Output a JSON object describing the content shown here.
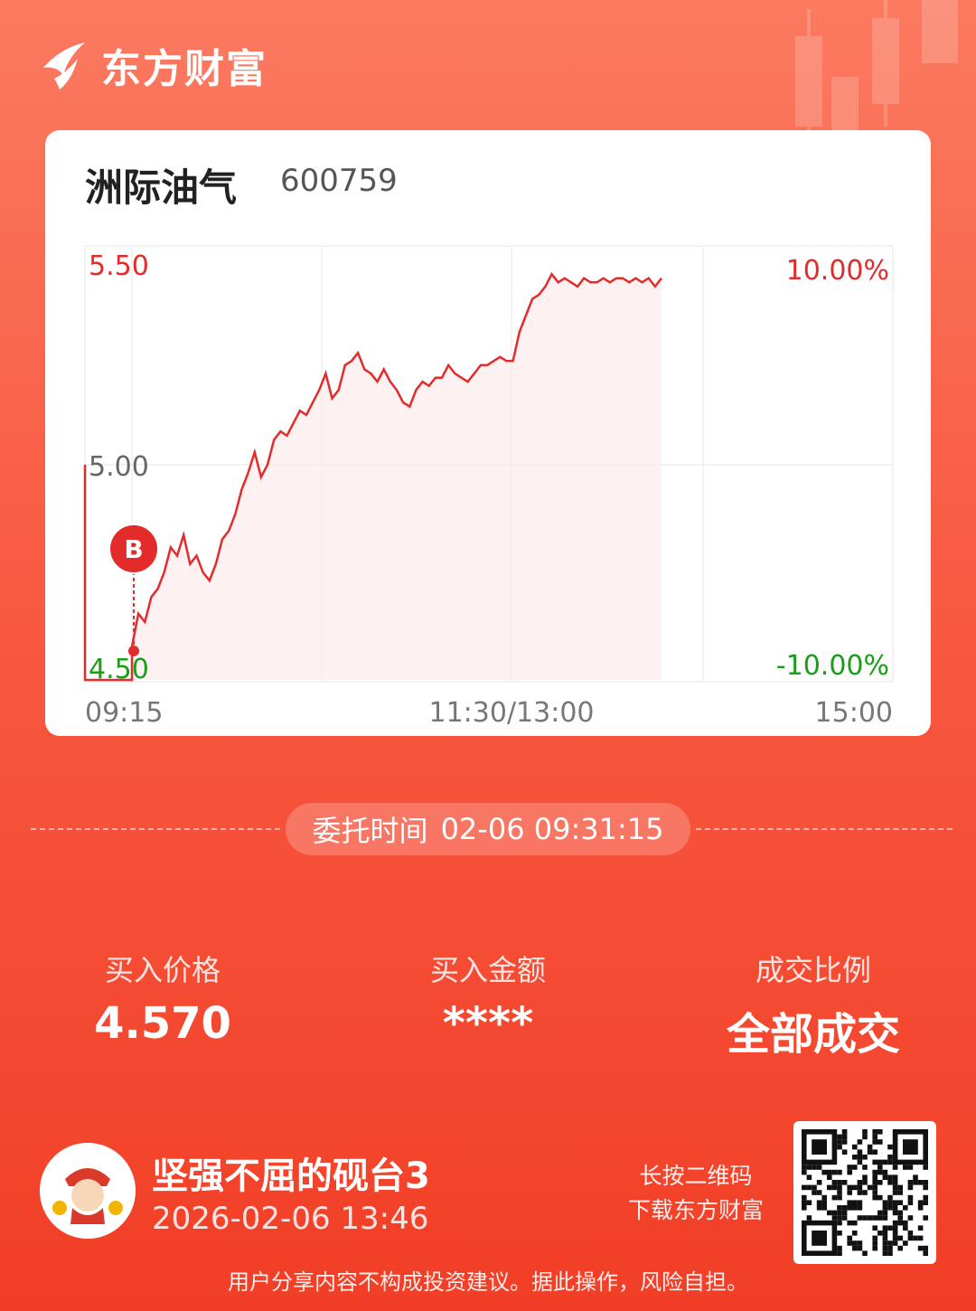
{
  "brand": {
    "name": "东方财富"
  },
  "stock": {
    "name": "洲际油气",
    "code": "600759"
  },
  "chart_data": {
    "type": "line",
    "y_axis_left": [
      "5.50",
      "5.00",
      "4.50"
    ],
    "y_axis_right": [
      "10.00%",
      "-10.00%"
    ],
    "x_labels": [
      "09:15",
      "11:30/13:00",
      "15:00"
    ],
    "ylim": [
      4.5,
      5.5
    ],
    "buy_marker": {
      "label": "B",
      "price": 4.57
    },
    "series": [
      {
        "values": [
          4.58,
          4.66,
          4.64,
          4.7,
          4.72,
          4.76,
          4.82,
          4.8,
          4.85,
          4.78,
          4.8,
          4.76,
          4.74,
          4.78,
          4.84,
          4.86,
          4.9,
          4.96,
          5.0,
          5.05,
          4.99,
          5.02,
          5.08,
          5.1,
          5.09,
          5.12,
          5.15,
          5.14,
          5.17,
          5.2,
          5.24,
          5.18,
          5.2,
          5.26,
          5.27,
          5.29,
          5.25,
          5.24,
          5.22,
          5.25,
          5.22,
          5.2,
          5.17,
          5.16,
          5.2,
          5.22,
          5.21,
          5.23,
          5.23,
          5.26,
          5.24,
          5.23,
          5.22,
          5.24,
          5.26,
          5.26,
          5.27,
          5.28,
          5.27,
          5.27,
          5.34,
          5.38,
          5.42,
          5.43,
          5.45,
          5.48,
          5.46,
          5.47,
          5.46,
          5.45,
          5.47,
          5.46,
          5.46,
          5.47,
          5.46,
          5.47,
          5.47,
          5.46,
          5.47,
          5.46,
          5.47,
          5.45,
          5.47
        ]
      }
    ]
  },
  "order_time": {
    "label": "委托时间",
    "value": "02-06 09:31:15"
  },
  "stats": [
    {
      "label": "买入价格",
      "value": "4.570"
    },
    {
      "label": "买入金额",
      "value": "****"
    },
    {
      "label": "成交比例",
      "value": "全部成交"
    }
  ],
  "user": {
    "name": "坚强不屈的砚台3",
    "time": "2026-02-06 13:46"
  },
  "qr_hint": {
    "line1": "长按二维码",
    "line2": "下载东方财富"
  },
  "disclaimer": "用户分享内容不构成投资建议。据此操作，风险自担。",
  "colors": {
    "up": "#e32b2b",
    "down": "#1a9e1a",
    "neutral": "#666666"
  }
}
